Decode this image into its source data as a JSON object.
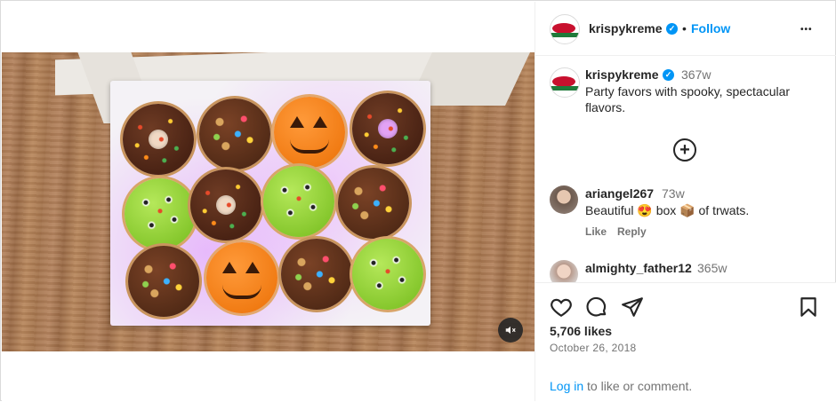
{
  "post": {
    "username": "krispykreme",
    "follow_label": "Follow",
    "separator": "•",
    "more_label": "•••",
    "caption_time": "367w",
    "caption_text": "Party favors with spooky, spectacular flavors.",
    "load_more_symbol": "+"
  },
  "comments": [
    {
      "username": "ariangel267",
      "time": "73w",
      "text_before": "Beautiful ",
      "emoji1": "😍",
      "text_mid": " box ",
      "emoji2": "📦",
      "text_after": " of trwats.",
      "like_label": "Like",
      "reply_label": "Reply"
    },
    {
      "username": "almighty_father12",
      "time": "365w"
    }
  ],
  "stats": {
    "likes": "5,706 likes",
    "date": "October 26, 2018"
  },
  "footer": {
    "login_link": "Log in",
    "login_rest": " to like or comment."
  },
  "colors": {
    "accent": "#0095f6",
    "text": "#262626",
    "muted": "#737373",
    "border": "#dbdbdb"
  },
  "icons": {
    "verified": "verified-badge-icon",
    "like": "heart-icon",
    "comment": "comment-bubble-icon",
    "share": "paper-plane-icon",
    "save": "bookmark-icon",
    "mute": "speaker-muted-icon",
    "more": "more-options-icon",
    "load_more": "plus-circle-icon"
  }
}
